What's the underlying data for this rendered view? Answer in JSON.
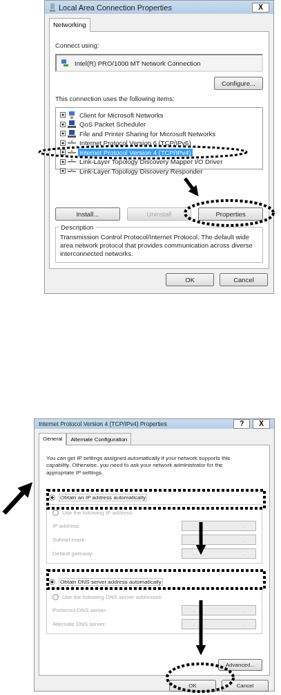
{
  "dialog_1": {
    "title": "Local Area Connection Properties",
    "close": "X",
    "tabs": [
      {
        "label": "Networking",
        "selected": true
      }
    ],
    "connect_using_label": "Connect using:",
    "adapter": "Intel(R) PRO/1000 MT Network Connection",
    "configure_button": "Configure...",
    "items_label": "This connection uses the following items:",
    "items": [
      {
        "label": "Client for Microsoft Networks",
        "checked": true,
        "selected": false,
        "kind": "client"
      },
      {
        "label": "QoS Packet Scheduler",
        "checked": true,
        "selected": false,
        "kind": "service"
      },
      {
        "label": "File and Printer Sharing for Microsoft Networks",
        "checked": true,
        "selected": false,
        "kind": "service"
      },
      {
        "label": "Internet Protocol Version 6 (TCP/IPv6)",
        "checked": true,
        "selected": false,
        "kind": "protocol"
      },
      {
        "label": "Internet Protocol Version 4 (TCP/IPv4)",
        "checked": true,
        "selected": true,
        "kind": "protocol"
      },
      {
        "label": "Link-Layer Topology Discovery Mapper I/O Driver",
        "checked": true,
        "selected": false,
        "kind": "protocol"
      },
      {
        "label": "Link-Layer Topology Discovery Responder",
        "checked": true,
        "selected": false,
        "kind": "protocol"
      }
    ],
    "item_buttons": [
      {
        "label": "Install...",
        "disabled": false
      },
      {
        "label": "Uninstall",
        "disabled": true
      },
      {
        "label": "Properties",
        "disabled": false
      }
    ],
    "description_label": "Description",
    "description": "Transmission Control Protocol/Internet Protocol. The default wide area network protocol that provides communication across diverse interconnected networks.",
    "buttons": [
      "OK",
      "Cancel"
    ]
  },
  "dialog_2": {
    "title": "Internet Protocol Version 4 (TCP/IPv4) Properties",
    "help": "?",
    "close": "X",
    "tabs": [
      {
        "label": "General",
        "selected": true
      },
      {
        "label": "Alternate Configuration",
        "selected": false
      }
    ],
    "intro": "You can get IP settings assigned automatically if your network supports this capability. Otherwise, you need to ask your network administrator for the appropriate IP settings.",
    "ip_options": [
      {
        "label": "Obtain an IP address automatically",
        "selected": true
      },
      {
        "label": "Use the following IP address:",
        "selected": false
      }
    ],
    "ip_fields": [
      {
        "label": "IP address:",
        "disabled": true,
        "dots": [
          ".",
          "."
        ]
      },
      {
        "label": "Subnet mask:",
        "disabled": true,
        "dots": [
          ".",
          "."
        ]
      },
      {
        "label": "Default gateway:",
        "disabled": true,
        "dots": [
          ".",
          "."
        ]
      }
    ],
    "dns_options": [
      {
        "label": "Obtain DNS server address automatically",
        "selected": true
      },
      {
        "label": "Use the following DNS server addresses:",
        "selected": false
      }
    ],
    "dns_fields": [
      {
        "label": "Preferred DNS server:",
        "disabled": true,
        "dots": [
          ".",
          "."
        ]
      },
      {
        "label": "Alternate DNS server:",
        "disabled": true,
        "dots": [
          ".",
          "."
        ]
      }
    ],
    "advanced_button": "Advanced...",
    "buttons": [
      "OK",
      "Cancel"
    ]
  }
}
